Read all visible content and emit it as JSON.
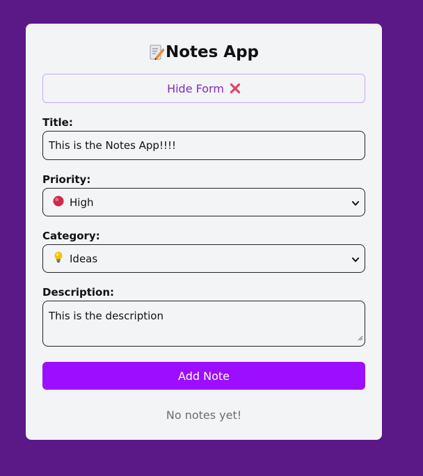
{
  "app": {
    "title": "Notes App",
    "title_icon": "memo-icon"
  },
  "toggle_form": {
    "label": "Hide Form",
    "icon": "close-x-icon",
    "icon_color": "#e0426a"
  },
  "form": {
    "title": {
      "label": "Title:",
      "value": "This is the Notes App!!!!"
    },
    "priority": {
      "label": "Priority:",
      "selected": "High",
      "icon": "red-circle-icon",
      "icon_color": "#d0284a"
    },
    "category": {
      "label": "Category:",
      "selected": "Ideas",
      "icon": "lightbulb-icon"
    },
    "description": {
      "label": "Description:",
      "value": "This is the description"
    },
    "submit_label": "Add Note"
  },
  "notes": {
    "empty_message": "No notes yet!"
  },
  "colors": {
    "page_background": "#5b1887",
    "card_background": "#f3f4f6",
    "accent": "#9c0eff",
    "toggle_text": "#7b2cbf",
    "toggle_border": "#c9a7ee"
  }
}
